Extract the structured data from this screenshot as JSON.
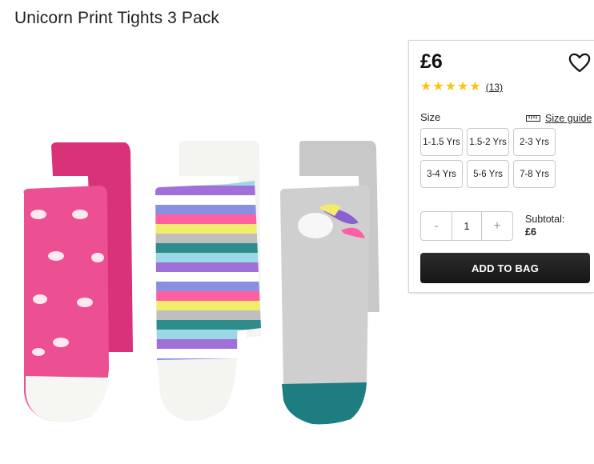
{
  "product": {
    "title": "Unicorn Print Tights 3 Pack"
  },
  "panel": {
    "price": "£6",
    "rating": {
      "stars": 5,
      "review_count": "(13)"
    },
    "size_label": "Size",
    "size_guide_label": "Size guide",
    "sizes": [
      "1-1.5 Yrs",
      "1.5-2 Yrs",
      "2-3 Yrs",
      "3-4 Yrs",
      "5-6 Yrs",
      "7-8 Yrs"
    ],
    "quantity": {
      "minus": "-",
      "value": "1",
      "plus": "+"
    },
    "subtotal_label": "Subtotal:",
    "subtotal_value": "£6",
    "add_to_bag_label": "ADD TO BAG"
  },
  "colors": {
    "star": "#f5c518",
    "button_bg": "#1f1f1f",
    "pink": "#e8448c",
    "teal": "#1a7d7d"
  }
}
